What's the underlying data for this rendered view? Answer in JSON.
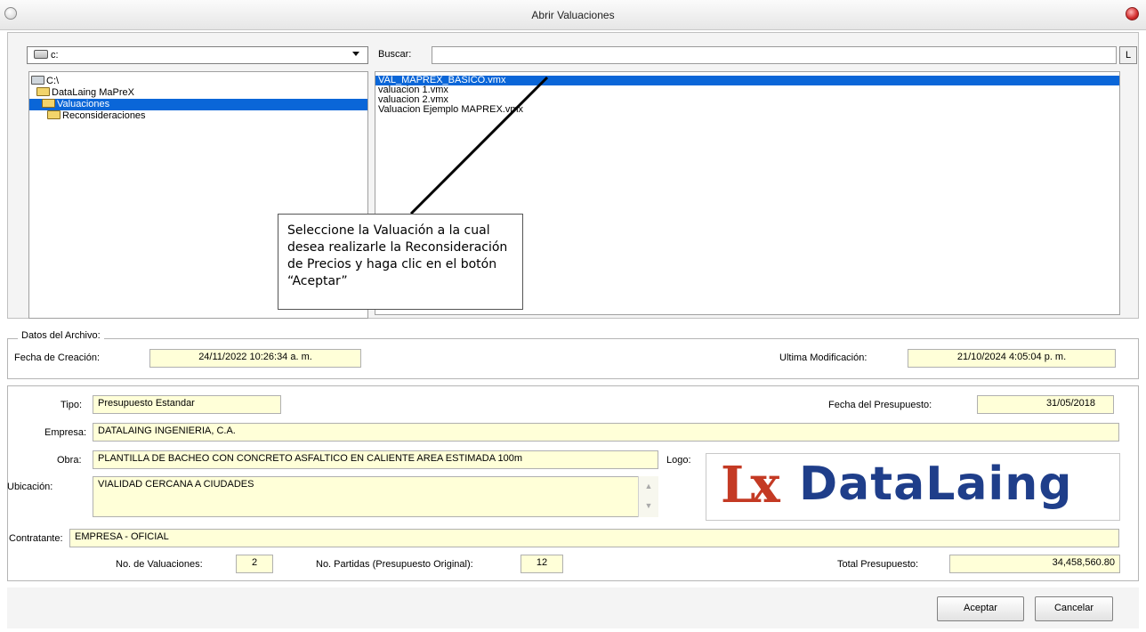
{
  "window": {
    "title": "Abrir Valuaciones"
  },
  "drive": {
    "value": "c:"
  },
  "folder_tree": [
    {
      "label": "C:\\",
      "icon": "drive-icon"
    },
    {
      "label": "DataLaing MaPreX",
      "icon": "folder-open-icon"
    },
    {
      "label": "Valuaciones",
      "icon": "folder-open-icon",
      "selected": true
    },
    {
      "label": "Reconsideraciones",
      "icon": "folder-icon"
    }
  ],
  "search": {
    "label": "Buscar:",
    "button": "L"
  },
  "files": [
    {
      "name": "VAL_MAPREX_BASICO.vmx",
      "selected": true
    },
    {
      "name": "valuacion 1.vmx"
    },
    {
      "name": "valuacion 2.vmx"
    },
    {
      "name": "Valuacion Ejemplo MAPREX.vmx"
    }
  ],
  "callout": {
    "line1": "Seleccione la Valuación a la cual",
    "line2": "desea realizarle la Reconsideración",
    "line3": "de Precios y haga clic en el botón",
    "line4": "“Aceptar”"
  },
  "file_data": {
    "legend": "Datos del Archivo:",
    "created_label": "Fecha de Creación:",
    "created_value": "24/11/2022 10:26:34 a. m.",
    "modified_label": "Ultima Modificación:",
    "modified_value": "21/10/2024 4:05:04 p. m."
  },
  "details": {
    "tipo_label": "Tipo:",
    "tipo_value": "Presupuesto Estandar",
    "fecha_label": "Fecha del Presupuesto:",
    "fecha_value": "31/05/2018",
    "empresa_label": "Empresa:",
    "empresa_value": "DATALAING INGENIERIA, C.A.",
    "obra_label": "Obra:",
    "obra_value": "PLANTILLA DE BACHEO CON CONCRETO ASFALTICO EN CALIENTE AREA ESTIMADA 100m",
    "logo_label": "Logo:",
    "ubicacion_label": "Ubicación:",
    "ubicacion_value": "VIALIDAD CERCANA A CIUDADES",
    "contratante_label": "Contratante:",
    "contratante_value": "EMPRESA - OFICIAL",
    "valuaciones_label": "No. de Valuaciones:",
    "valuaciones_value": "2",
    "partidas_label": "No. Partidas (Presupuesto Original):",
    "partidas_value": "12",
    "total_label": "Total Presupuesto:",
    "total_value": "34,458,560.80"
  },
  "logo": {
    "mark": "Lx",
    "name": "DataLaing"
  },
  "buttons": {
    "accept": "Aceptar",
    "cancel": "Cancelar"
  }
}
